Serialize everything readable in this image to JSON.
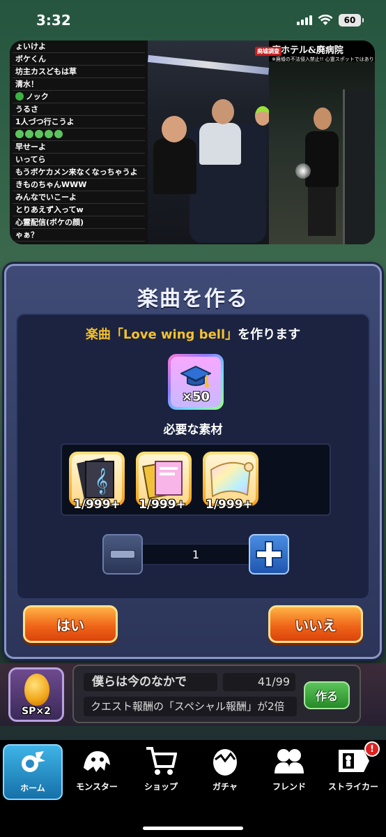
{
  "status_bar": {
    "time": "3:32",
    "battery": "60"
  },
  "stream": {
    "chat": [
      "ょいけよ",
      "ボケくん",
      "坊主カスどもは草",
      "清水！",
      "ノック",
      "うるさ",
      "1人づつ行こうよ",
      "",
      "早せーよ",
      "いってら",
      "もうボケカメン来なくなっちゃうよ",
      "きものちゃんWWW",
      "みんなでいこーよ",
      "とりあえず入ってw",
      "心霊配信(ボケの顔)",
      "ゃぁ？"
    ],
    "banner_title": "廃ホテル&廃病院",
    "banner_tag": "廃墟調査",
    "banner_sub": "※廃墟の不法侵入禁止!! 心霊スポットではありません!!"
  },
  "dialog": {
    "title": "楽曲を作る",
    "message_prefix": "楽曲",
    "song": "「Love wing bell」",
    "message_suffix": "を作ります",
    "reward_count": "×50",
    "materials_label": "必要な素材",
    "materials": [
      {
        "icon": "music-sheets-icon",
        "count": "1/999+"
      },
      {
        "icon": "pink-notebooks-icon",
        "count": "1/999+"
      },
      {
        "icon": "rainbow-scroll-icon",
        "count": "1/999+"
      }
    ],
    "quantity": "1",
    "yes_label": "はい",
    "no_label": "いいえ"
  },
  "quest": {
    "sp_label": "SP×2",
    "name": "僕らは今のなかで",
    "progress": "41/99",
    "description": "クエスト報酬の「スペシャル報酬」が2倍",
    "make_label": "作る"
  },
  "nav": {
    "items": [
      {
        "label": "ホーム",
        "icon": "home-icon"
      },
      {
        "label": "モンスター",
        "icon": "monster-icon"
      },
      {
        "label": "ショップ",
        "icon": "cart-icon"
      },
      {
        "label": "ガチャ",
        "icon": "gacha-egg-icon"
      },
      {
        "label": "フレンド",
        "icon": "friends-icon"
      },
      {
        "label": "ストライカー",
        "icon": "striker-card-icon"
      }
    ],
    "striker_badge": "!"
  }
}
